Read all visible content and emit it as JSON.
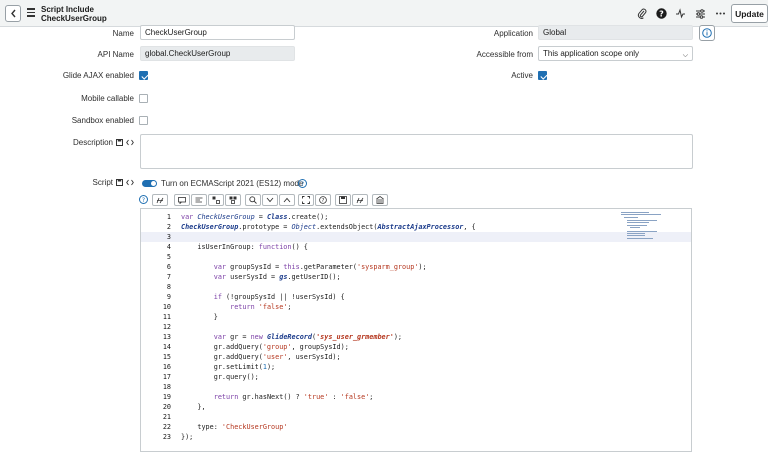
{
  "header": {
    "title_line1": "Script Include",
    "title_line2": "CheckUserGroup",
    "update_label": "Update",
    "icons": [
      "back-icon",
      "menu-icon",
      "paperclip-icon",
      "help-icon",
      "activity-icon",
      "settings-sliders-icon",
      "more-icon"
    ]
  },
  "form": {
    "name_label": "Name",
    "name_value": "CheckUserGroup",
    "api_name_label": "API Name",
    "api_name_value": "global.CheckUserGroup",
    "glide_ajax_label": "Glide AJAX enabled",
    "glide_ajax_checked": true,
    "mobile_callable_label": "Mobile callable",
    "mobile_callable_checked": false,
    "sandbox_label": "Sandbox enabled",
    "sandbox_checked": false,
    "description_label": "Description",
    "description_value": "",
    "application_label": "Application",
    "application_value": "Global",
    "accessible_label": "Accessible from",
    "accessible_value": "This application scope only",
    "active_label": "Active",
    "active_checked": true,
    "script_label": "Script",
    "es12_label": "Turn on ECMAScript 2021 (ES12) mode"
  },
  "colors": {
    "accent": "#1f6fb2",
    "header_bg": "#f2f4f4",
    "keyword": "#7b3fa6",
    "string": "#b5371f"
  },
  "code": {
    "line_numbers": [
      "1",
      "2",
      "3",
      "4",
      "5",
      "6",
      "7",
      "8",
      "9",
      "10",
      "11",
      "12",
      "13",
      "14",
      "15",
      "16",
      "17",
      "18",
      "19",
      "20",
      "21",
      "22",
      "23"
    ]
  }
}
